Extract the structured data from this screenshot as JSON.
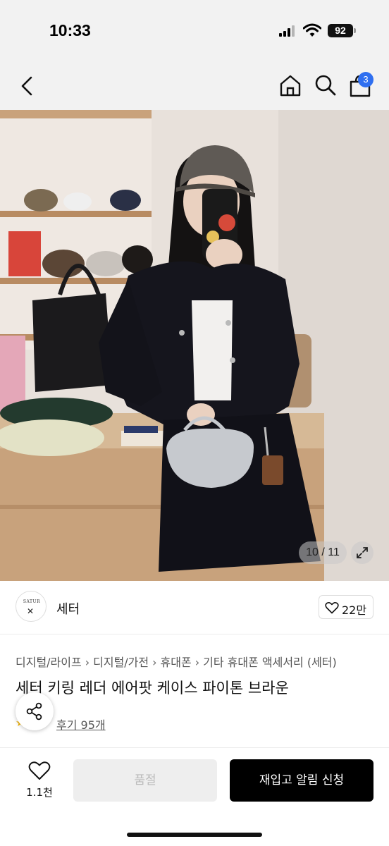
{
  "status_bar": {
    "time": "10:33",
    "battery": "92"
  },
  "nav": {
    "cart_count": "3"
  },
  "photo": {
    "counter": "10 / 11"
  },
  "seller": {
    "name": "세터",
    "logo_text": "SATUR",
    "likes": "22만"
  },
  "product": {
    "breadcrumb": [
      "디지털/라이프",
      "디지털/가전",
      "휴대폰",
      "기타 휴대폰 액세서리 (세터)"
    ],
    "title": "세터 키링 레더 에어팟 케이스 파이톤 브라운",
    "review_link": "후기 95개"
  },
  "bottom_bar": {
    "wish_count": "1.1천",
    "soldout_label": "품절",
    "restock_label": "재입고 알림 신청"
  },
  "colors": {
    "accent": "#2f6ff0",
    "primary_button": "#000000",
    "disabled_button": "#eeeeee"
  }
}
